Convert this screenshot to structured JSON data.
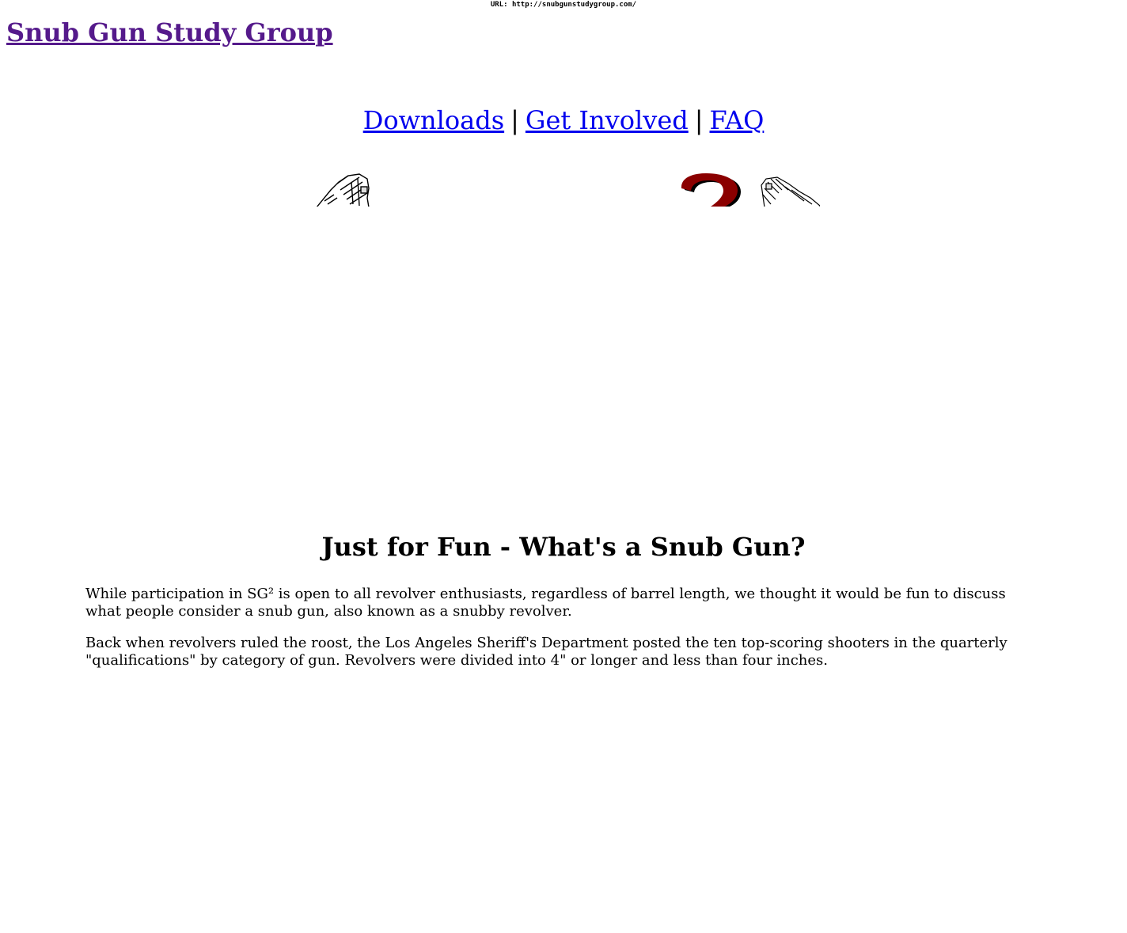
{
  "browser": {
    "url_label": "URL: http://snubgunstudygroup.com/"
  },
  "header": {
    "site_title": "Snub Gun Study Group"
  },
  "nav": {
    "items": [
      {
        "label": "Downloads"
      },
      {
        "label": "Get Involved"
      },
      {
        "label": "FAQ"
      }
    ],
    "separator": "|"
  },
  "logo": {
    "icons": [
      "revolver-left-icon",
      "question-mark-icon",
      "revolver-right-icon"
    ],
    "accent_color": "#8b0000"
  },
  "article": {
    "heading": "Just for Fun - What's a Snub Gun?",
    "paragraphs": [
      "While participation in SG² is open to all revolver enthusiasts, regardless of barrel length, we thought it would be fun to discuss what people consider a snub gun, also known as a snubby revolver.",
      "Back when revolvers ruled the roost, the Los Angeles Sheriff's Department posted the ten top-scoring shooters in the quarterly \"qualifications\" by category of gun. Revolvers were divided into 4\" or longer and less than four inches."
    ]
  },
  "colors": {
    "visited_link": "#551a8b",
    "link": "#0000ee",
    "text": "#000000",
    "background": "#ffffff"
  }
}
